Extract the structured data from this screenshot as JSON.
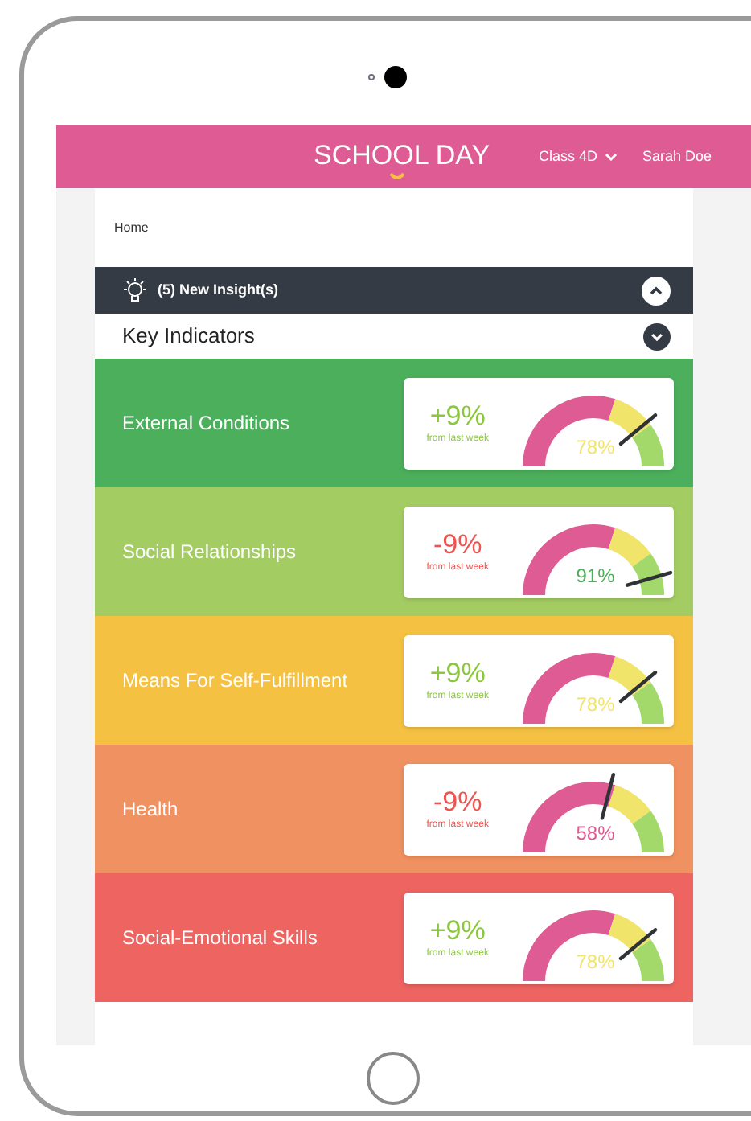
{
  "header": {
    "logo": "SCHOOL DAY",
    "class_selector": "Class 4D",
    "user": "Sarah Doe"
  },
  "breadcrumb": "Home",
  "insights_bar": {
    "label": "(5) New Insight(s)"
  },
  "section": {
    "title": "Key Indicators"
  },
  "indicators": [
    {
      "name": "External Conditions",
      "color": "#4caf5c",
      "change": "+9%",
      "kind": "increase",
      "change_note": "from last week",
      "reading": "78%",
      "level": 0.78
    },
    {
      "name": "Social Relationships",
      "color": "#a3cd62",
      "change": "-9%",
      "kind": "decrease",
      "change_note": "from last week",
      "reading": "91%",
      "level": 0.91
    },
    {
      "name": "Means For Self-Fulfillment",
      "color": "#f4c143",
      "change": "+9%",
      "kind": "increase",
      "change_note": "from last week",
      "reading": "78%",
      "level": 0.78
    },
    {
      "name": "Health",
      "color": "#ef9160",
      "change": "-9%",
      "kind": "decrease",
      "change_note": "from last week",
      "reading": "58%",
      "level": 0.58
    },
    {
      "name": "Social-Emotional Skills",
      "color": "#ed6461",
      "change": "+9%",
      "kind": "increase",
      "change_note": "from last week",
      "reading": "78%",
      "level": 0.78
    }
  ]
}
